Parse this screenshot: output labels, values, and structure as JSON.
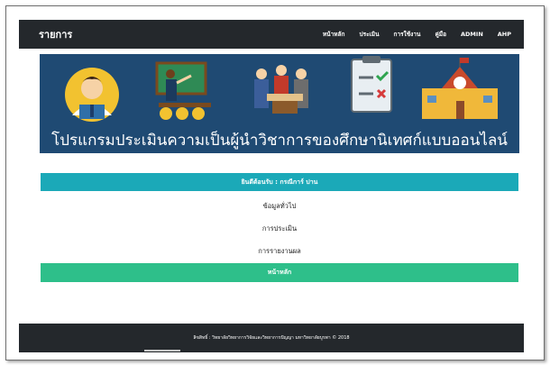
{
  "navbar": {
    "brand": "รายการ",
    "items": [
      "หน้าหลัก",
      "ประเมิน",
      "การใช้งาน",
      "คู่มือ",
      "ADMIN",
      "AHP"
    ]
  },
  "banner": {
    "title": "โปรแกรมประเมินความเป็นผู้นำวิชาการของศึกษานิเทศก์แบบออนไลน์"
  },
  "welcome": "ยินดีต้อนรับ : กรณีการ์ ปาน",
  "menu": {
    "general": "ข้อมูลทั่วไป",
    "evaluate": "การประเมิน",
    "report": "การรายงานผล"
  },
  "home_button": "หน้าหลัก",
  "footer": "ลิขสิทธิ์ : วิทยาลัยวิทยาการวิจัยและวิทยาการปัญญา มหาวิทยาลัยบูรพา © 2018",
  "colors": {
    "navbar_bg": "#24282c",
    "banner_bg": "#1f4a73",
    "welcome_bg": "#1ba9b8",
    "home_button_bg": "#2ebf8a"
  }
}
